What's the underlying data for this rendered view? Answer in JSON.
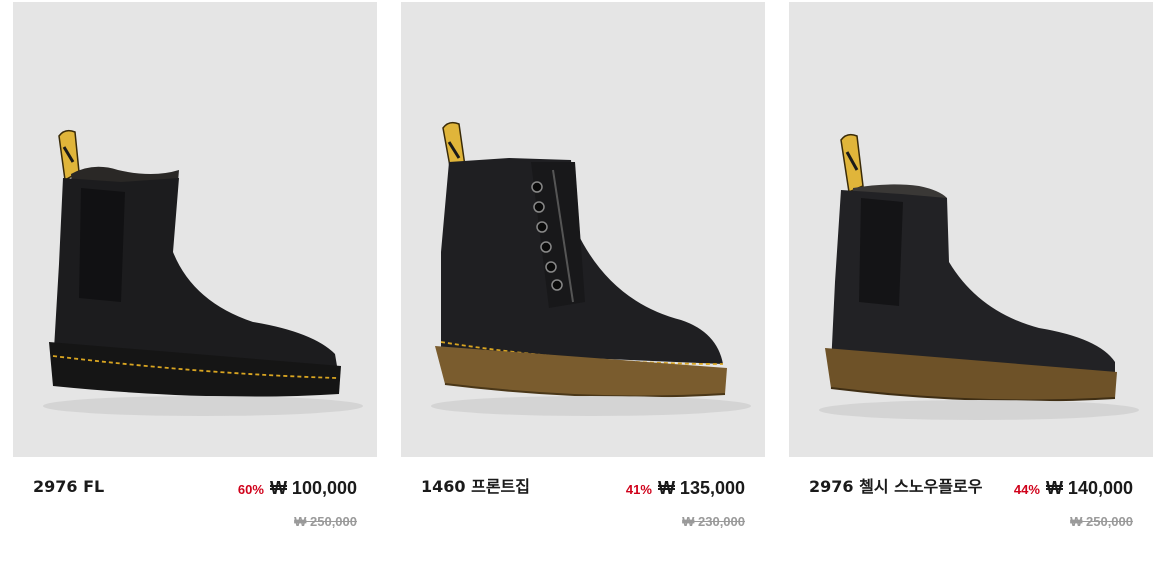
{
  "products": [
    {
      "name": "2976 FL",
      "discount": "60%",
      "price": "₩ 100,000",
      "original_price": "₩ 250,000",
      "image_icon": "chelsea-boot-fur-lined-icon"
    },
    {
      "name": "1460 프론트집",
      "discount": "41%",
      "price": "₩ 135,000",
      "original_price": "₩ 230,000",
      "image_icon": "lace-up-boot-front-zip-icon"
    },
    {
      "name": "2976 첼시 스노우플로우",
      "discount": "44%",
      "price": "₩ 140,000",
      "original_price": "₩ 250,000",
      "image_icon": "chelsea-boot-snowplow-icon"
    }
  ],
  "colors": {
    "thumb_bg": "#e5e5e5",
    "discount": "#d0021b",
    "price": "#1a1a1a",
    "original_price": "#9a9a9a",
    "boot_leather": "#1c1c1e",
    "stitch": "#d9a521",
    "pull_tab": "#e0b53a"
  }
}
